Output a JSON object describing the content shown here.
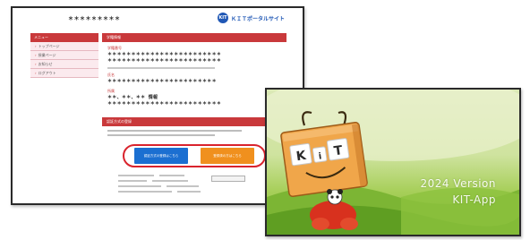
{
  "portal": {
    "masked_id": "＊＊＊＊＊＊＊＊＊",
    "brand": {
      "logo_text": "KIT",
      "name": "ＫＩＴポータルサイト"
    },
    "sidebar": {
      "header": "メニュー",
      "items": [
        "トップページ",
        "授業ページ",
        "お知らせ",
        "ログアウト"
      ]
    },
    "profile": {
      "section_title": "学籍情報",
      "label_1": "学籍番号",
      "value_1a": "＊＊＊＊＊＊＊＊＊＊＊＊＊＊＊＊＊＊＊＊＊＊＊＊",
      "value_1b": "＊＊＊＊＊＊＊＊＊＊＊＊＊＊＊＊＊＊＊＊＊＊＊＊",
      "label_2": "氏名",
      "value_2a": "＊＊＊＊＊＊＊＊＊＊＊＊＊＊＊＊＊＊＊＊＊＊＊",
      "label_3": "所属",
      "value_3a": "＊＊、＊＊、＊＊ 情報",
      "value_3b": "＊＊＊＊＊＊＊＊＊＊＊＊＊＊＊＊＊＊＊＊＊＊＊＊"
    },
    "auth": {
      "section_title": "認証方式の登録",
      "button_primary": "認証方式の登録はこちら",
      "button_secondary": "登録済の方はこちら"
    }
  },
  "splash": {
    "character_text": [
      "K",
      "i",
      "T"
    ],
    "line1": "2024 Version",
    "line2": "KIT-App"
  }
}
